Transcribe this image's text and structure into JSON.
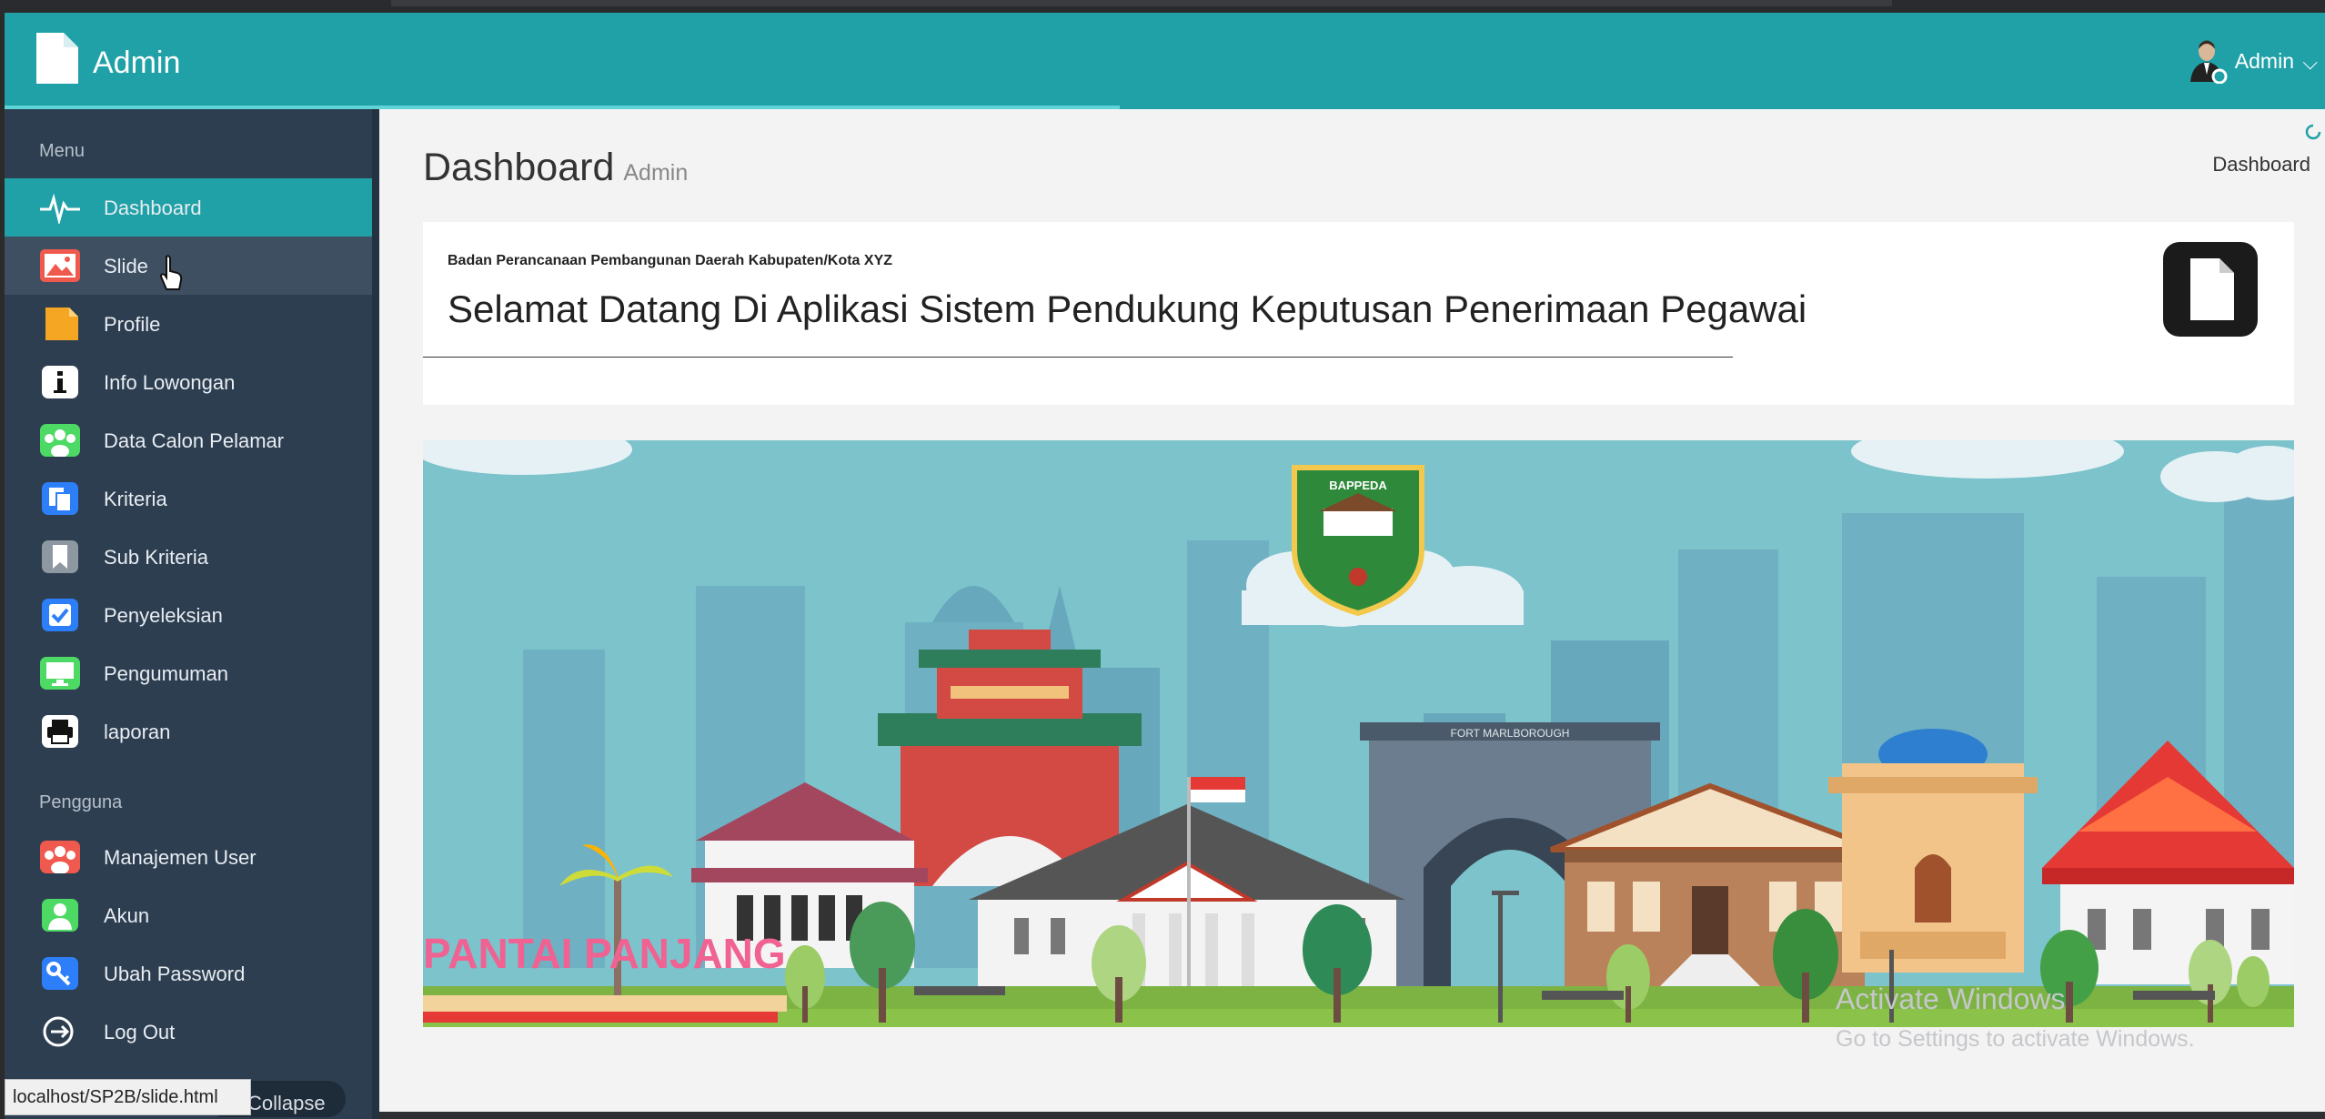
{
  "header": {
    "brand": "Admin",
    "user_name": "Admin",
    "chevron": "⌵",
    "icons": [
      "document-icon",
      "user-avatar-icon",
      "chevron-down-icon"
    ]
  },
  "sidebar": {
    "section_menu": "Menu",
    "menu_items": [
      {
        "label": "Dashboard",
        "icon": "pulse-icon"
      },
      {
        "label": "Slide",
        "icon": "image-icon"
      },
      {
        "label": "Profile",
        "icon": "file-icon"
      },
      {
        "label": "Info Lowongan",
        "icon": "info-icon"
      },
      {
        "label": "Data Calon Pelamar",
        "icon": "users-icon"
      },
      {
        "label": "Kriteria",
        "icon": "copy-icon"
      },
      {
        "label": "Sub Kriteria",
        "icon": "bookmark-icon"
      },
      {
        "label": "Penyeleksian",
        "icon": "checkbox-icon"
      },
      {
        "label": "Pengumuman",
        "icon": "monitor-icon"
      },
      {
        "label": "laporan",
        "icon": "printer-icon"
      }
    ],
    "section_user": "Pengguna",
    "user_items": [
      {
        "label": "Manajemen User",
        "icon": "users-icon"
      },
      {
        "label": "Akun",
        "icon": "user-icon"
      },
      {
        "label": "Ubah Password",
        "icon": "key-icon"
      },
      {
        "label": "Log Out",
        "icon": "logout-icon"
      }
    ],
    "collapse_label": "Collapse"
  },
  "main": {
    "title": "Dashboard",
    "subtitle": "Admin",
    "breadcrumb": "Dashboard",
    "org": "Badan Perancanaan Pembangunan Daerah Kabupaten/Kota XYZ",
    "welcome": "Selamat Datang Di Aplikasi Sistem Pendukung Keputusan Penerimaan Pegawai"
  },
  "banner": {
    "badge_text": "BAPPEDA",
    "fort_label": "FORT MARLBOROUGH",
    "beach_text": "PANTAI PANJANG"
  },
  "watermark": {
    "line1": "Activate Windows",
    "line2": "Go to Settings to activate Windows."
  },
  "status_url": "localhost/SP2B/slide.html",
  "colors": {
    "header": "#1fa1a7",
    "sidebar": "#2d3e50",
    "active": "#1fa1a7",
    "sky": "#7cc3cc"
  }
}
